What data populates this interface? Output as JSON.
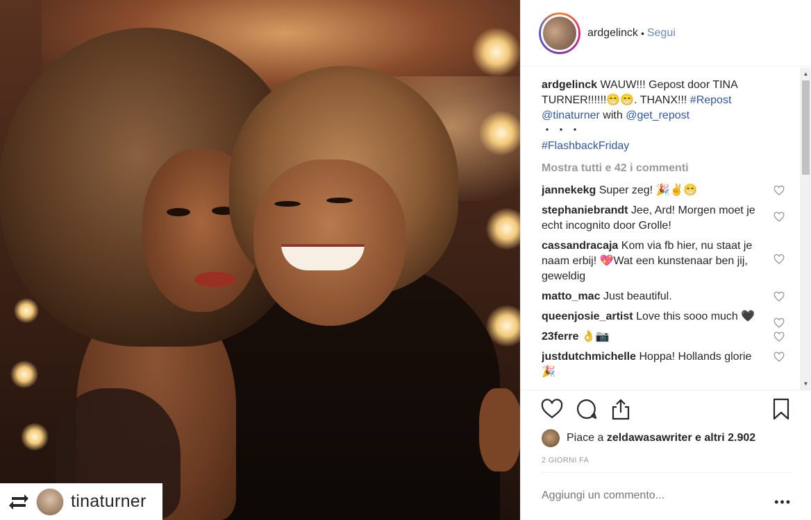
{
  "photo": {
    "repost_name": "tinaturner"
  },
  "header": {
    "username": "ardgelinck",
    "separator": "•",
    "follow": "Segui"
  },
  "caption": {
    "user": "ardgelinck",
    "text": "WAUW!!! Gepost door TINA TURNER!!!!!!😁😁. THANX!!!",
    "tag_repost": "#Repost",
    "mention_tina": "@tinaturner",
    "with": "with",
    "mention_repost": "@get_repost",
    "dots": "・・・",
    "tag_flashback": "#FlashbackFriday"
  },
  "show_all": "Mostra tutti e 42 i commenti",
  "comments": [
    {
      "user": "jannekekg",
      "text": "Super zeg! 🎉✌😁"
    },
    {
      "user": "stephaniebrandt",
      "text": "Jee, Ard! Morgen moet je echt incognito door Grolle!"
    },
    {
      "user": "cassandracaja",
      "text": "Kom via fb hier, nu staat je naam erbij! 💖Wat een kunstenaar ben jij, geweldig"
    },
    {
      "user": "matto_mac",
      "text": "Just beautiful."
    },
    {
      "user": "queenjosie_artist",
      "text": "Love this sooo much 🖤"
    },
    {
      "user": "23ferre",
      "text": "👌📷"
    },
    {
      "user": "justdutchmichelle",
      "text": "Hoppa! Hollands glorie🎉"
    }
  ],
  "likes": {
    "prefix": "Piace a",
    "user": "zeldawasawriter",
    "suffix": "e altri 2.902"
  },
  "time": "2 GIORNI FA",
  "add_comment_placeholder": "Aggiungi un commento...",
  "more_label": "•••",
  "colors": {
    "link": "#2f56a3",
    "follow": "#6b8ab8",
    "muted": "#999999"
  }
}
